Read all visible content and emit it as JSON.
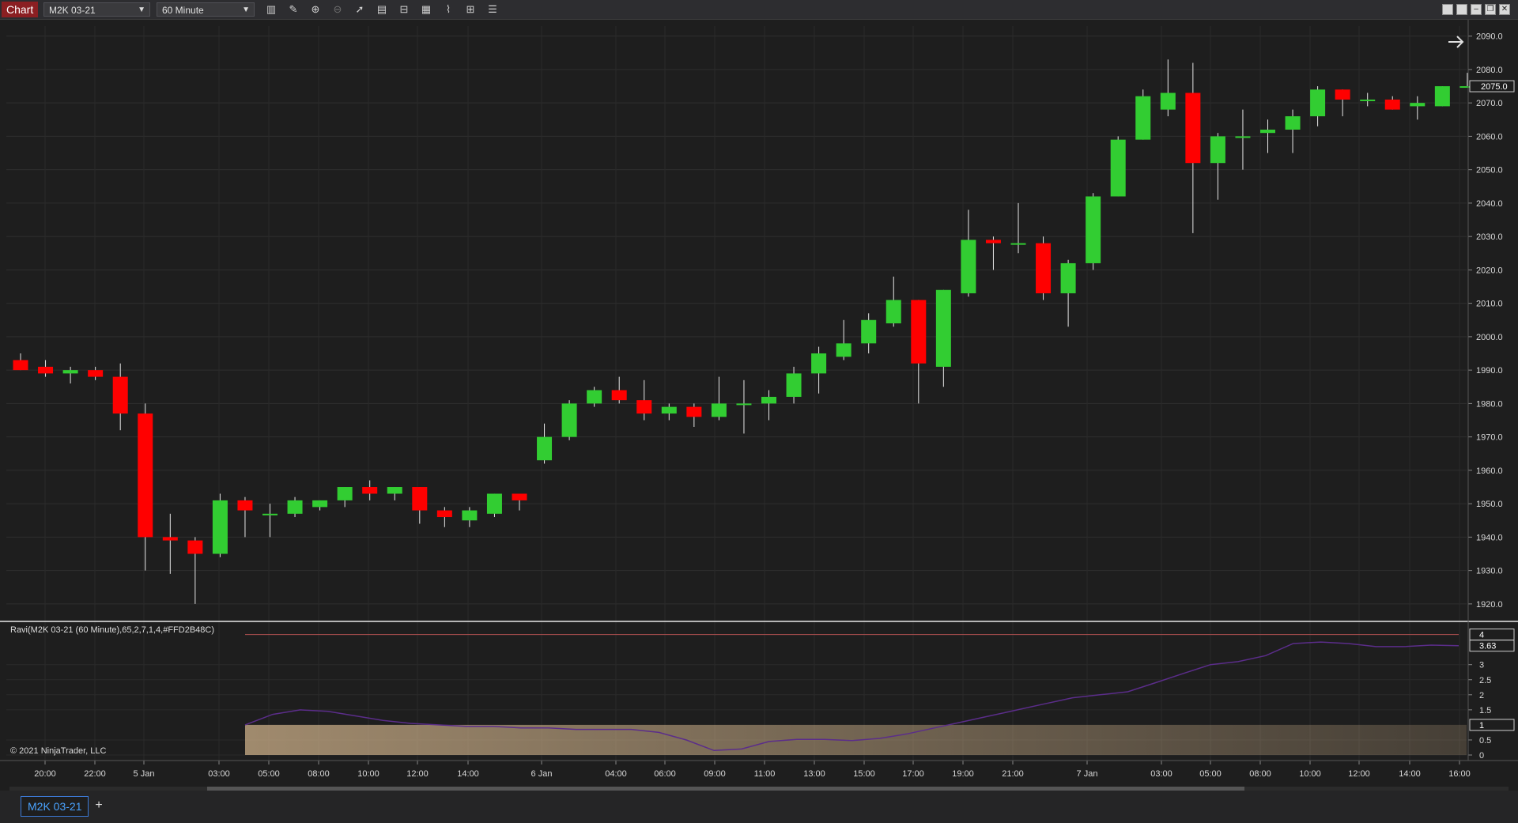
{
  "toolbar": {
    "chart_label": "Chart",
    "instrument": "M2K 03-21",
    "interval": "60 Minute",
    "tools": [
      "bars-type-icon",
      "drawing-tool-icon",
      "zoom-in-icon",
      "zoom-out-icon",
      "pointer-icon",
      "data-box-icon",
      "properties-icon",
      "template-icon",
      "strategies-icon",
      "indicators-icon",
      "list-icon"
    ]
  },
  "price_axis": {
    "labels": [
      "2090.0",
      "2080.0",
      "2070.0",
      "2060.0",
      "2050.0",
      "2040.0",
      "2030.0",
      "2020.0",
      "2010.0",
      "2000.0",
      "1990.0",
      "1980.0",
      "1970.0",
      "1960.0",
      "1950.0",
      "1940.0",
      "1930.0",
      "1920.0"
    ],
    "last_price": "2075.0"
  },
  "indicator": {
    "label": "Ravi(M2K 03-21 (60 Minute),65,2,7,1,4,#FFD2B48C)",
    "axis_labels": [
      "3",
      "2.5",
      "2",
      "1.5",
      "0.5",
      "0"
    ],
    "upper_level": "4",
    "current_value": "3.63",
    "lower_level": "1",
    "band_color": "#D2B48C"
  },
  "time_axis": {
    "labels": [
      "20:00",
      "22:00",
      "5 Jan",
      "03:00",
      "05:00",
      "08:00",
      "10:00",
      "12:00",
      "14:00",
      "6 Jan",
      "04:00",
      "06:00",
      "09:00",
      "11:00",
      "13:00",
      "15:00",
      "17:00",
      "19:00",
      "21:00",
      "7 Jan",
      "03:00",
      "05:00",
      "08:00",
      "10:00",
      "12:00",
      "14:00",
      "16:00"
    ]
  },
  "chart_data": {
    "type": "candlestick",
    "up_color": "#32CD32",
    "down_color": "#FF0000",
    "candles": [
      {
        "o": 1993,
        "h": 1995,
        "l": 1990,
        "c": 1990
      },
      {
        "o": 1991,
        "h": 1993,
        "l": 1988,
        "c": 1989
      },
      {
        "o": 1989,
        "h": 1991,
        "l": 1986,
        "c": 1990
      },
      {
        "o": 1990,
        "h": 1991,
        "l": 1987,
        "c": 1988
      },
      {
        "o": 1988,
        "h": 1992,
        "l": 1972,
        "c": 1977
      },
      {
        "o": 1977,
        "h": 1980,
        "l": 1930,
        "c": 1940
      },
      {
        "o": 1940,
        "h": 1947,
        "l": 1929,
        "c": 1939
      },
      {
        "o": 1939,
        "h": 1940,
        "l": 1920,
        "c": 1935
      },
      {
        "o": 1935,
        "h": 1953,
        "l": 1934,
        "c": 1951
      },
      {
        "o": 1951,
        "h": 1952,
        "l": 1940,
        "c": 1948
      },
      {
        "o": 1947,
        "h": 1950,
        "l": 1940,
        "c": 1947
      },
      {
        "o": 1947,
        "h": 1952,
        "l": 1946,
        "c": 1951
      },
      {
        "o": 1949,
        "h": 1951,
        "l": 1948,
        "c": 1951
      },
      {
        "o": 1951,
        "h": 1955,
        "l": 1949,
        "c": 1955
      },
      {
        "o": 1955,
        "h": 1957,
        "l": 1951,
        "c": 1953
      },
      {
        "o": 1953,
        "h": 1955,
        "l": 1951,
        "c": 1955
      },
      {
        "o": 1955,
        "h": 1955,
        "l": 1944,
        "c": 1948
      },
      {
        "o": 1948,
        "h": 1949,
        "l": 1943,
        "c": 1946
      },
      {
        "o": 1945,
        "h": 1949,
        "l": 1943,
        "c": 1948
      },
      {
        "o": 1947,
        "h": 1953,
        "l": 1946,
        "c": 1953
      },
      {
        "o": 1953,
        "h": 1953,
        "l": 1948,
        "c": 1951
      },
      {
        "o": 1963,
        "h": 1974,
        "l": 1962,
        "c": 1970
      },
      {
        "o": 1970,
        "h": 1981,
        "l": 1969,
        "c": 1980
      },
      {
        "o": 1980,
        "h": 1985,
        "l": 1979,
        "c": 1984
      },
      {
        "o": 1984,
        "h": 1988,
        "l": 1980,
        "c": 1981
      },
      {
        "o": 1981,
        "h": 1987,
        "l": 1975,
        "c": 1977
      },
      {
        "o": 1977,
        "h": 1980,
        "l": 1975,
        "c": 1979
      },
      {
        "o": 1979,
        "h": 1980,
        "l": 1973,
        "c": 1976
      },
      {
        "o": 1976,
        "h": 1988,
        "l": 1975,
        "c": 1980
      },
      {
        "o": 1980,
        "h": 1987,
        "l": 1971,
        "c": 1980
      },
      {
        "o": 1980,
        "h": 1984,
        "l": 1975,
        "c": 1982
      },
      {
        "o": 1982,
        "h": 1991,
        "l": 1980,
        "c": 1989
      },
      {
        "o": 1989,
        "h": 1997,
        "l": 1983,
        "c": 1995
      },
      {
        "o": 1994,
        "h": 2005,
        "l": 1993,
        "c": 1998
      },
      {
        "o": 1998,
        "h": 2007,
        "l": 1995,
        "c": 2005
      },
      {
        "o": 2004,
        "h": 2018,
        "l": 2003,
        "c": 2011
      },
      {
        "o": 2011,
        "h": 2011,
        "l": 1980,
        "c": 1992
      },
      {
        "o": 1991,
        "h": 2014,
        "l": 1985,
        "c": 2014
      },
      {
        "o": 2013,
        "h": 2038,
        "l": 2012,
        "c": 2029
      },
      {
        "o": 2029,
        "h": 2030,
        "l": 2020,
        "c": 2028
      },
      {
        "o": 2028,
        "h": 2040,
        "l": 2025,
        "c": 2028
      },
      {
        "o": 2028,
        "h": 2030,
        "l": 2011,
        "c": 2013
      },
      {
        "o": 2013,
        "h": 2023,
        "l": 2003,
        "c": 2022
      },
      {
        "o": 2022,
        "h": 2043,
        "l": 2020,
        "c": 2042
      },
      {
        "o": 2042,
        "h": 2060,
        "l": 2042,
        "c": 2059
      },
      {
        "o": 2059,
        "h": 2074,
        "l": 2059,
        "c": 2072
      },
      {
        "o": 2068,
        "h": 2083,
        "l": 2066,
        "c": 2073
      },
      {
        "o": 2073,
        "h": 2082,
        "l": 2031,
        "c": 2052
      },
      {
        "o": 2052,
        "h": 2061,
        "l": 2041,
        "c": 2060
      },
      {
        "o": 2060,
        "h": 2068,
        "l": 2050,
        "c": 2060
      },
      {
        "o": 2061,
        "h": 2065,
        "l": 2055,
        "c": 2062
      },
      {
        "o": 2062,
        "h": 2068,
        "l": 2055,
        "c": 2066
      },
      {
        "o": 2066,
        "h": 2075,
        "l": 2063,
        "c": 2074
      },
      {
        "o": 2074,
        "h": 2074,
        "l": 2066,
        "c": 2071
      },
      {
        "o": 2071,
        "h": 2073,
        "l": 2069,
        "c": 2071
      },
      {
        "o": 2071,
        "h": 2072,
        "l": 2068,
        "c": 2068
      },
      {
        "o": 2069,
        "h": 2072,
        "l": 2065,
        "c": 2070
      },
      {
        "o": 2069,
        "h": 2075,
        "l": 2069,
        "c": 2075
      },
      {
        "o": 2075,
        "h": 2079,
        "l": 2075,
        "c": 2075
      }
    ],
    "ravi": [
      1.0,
      1.35,
      1.5,
      1.45,
      1.3,
      1.15,
      1.05,
      1.0,
      0.95,
      0.95,
      0.9,
      0.9,
      0.85,
      0.85,
      0.85,
      0.75,
      0.5,
      0.15,
      0.2,
      0.45,
      0.52,
      0.52,
      0.48,
      0.55,
      0.7,
      0.9,
      1.1,
      1.3,
      1.5,
      1.7,
      1.9,
      2.0,
      2.1,
      2.4,
      2.7,
      3.0,
      3.1,
      3.3,
      3.7,
      3.75,
      3.7,
      3.6,
      3.6,
      3.65,
      3.63
    ],
    "ylim": [
      1915,
      2093
    ],
    "indicator_ylim": [
      0,
      4.2
    ]
  }
}
